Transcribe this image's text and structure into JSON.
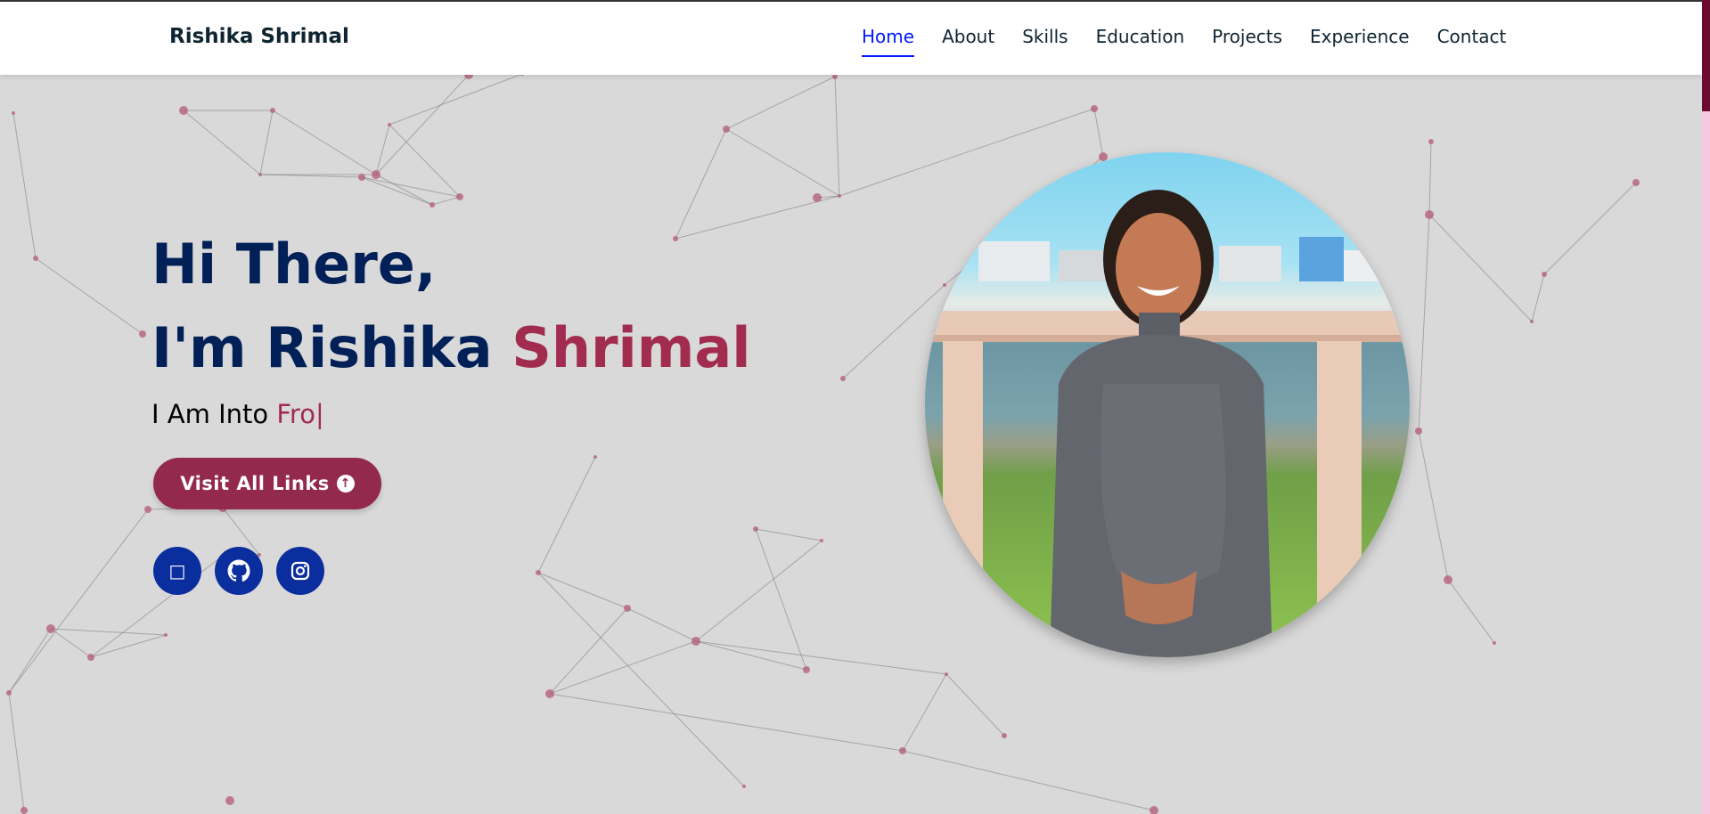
{
  "brand": "Rishika Shrimal",
  "nav": [
    {
      "label": "Home",
      "active": true
    },
    {
      "label": "About"
    },
    {
      "label": "Skills"
    },
    {
      "label": "Education"
    },
    {
      "label": "Projects"
    },
    {
      "label": "Experience"
    },
    {
      "label": "Contact"
    }
  ],
  "hero": {
    "greeting": "Hi There,",
    "im": "I'm Rishika ",
    "surname": "Shrimal",
    "typing_prefix": "I Am Into ",
    "typing_text": "Fro",
    "cursor": "|",
    "button_label": "Visit All Links",
    "button_icon": "arrow-up-circle-icon"
  },
  "socials": [
    {
      "name": "linkedin-icon",
      "glyph": "□"
    },
    {
      "name": "github-icon",
      "glyph": ""
    },
    {
      "name": "instagram-icon",
      "glyph": ""
    }
  ],
  "colors": {
    "accent": "#a12c50",
    "heading": "#002057",
    "button": "#93294c",
    "social": "#0b2e9e",
    "nav_active": "#011aff",
    "background": "#d9d9d9"
  }
}
